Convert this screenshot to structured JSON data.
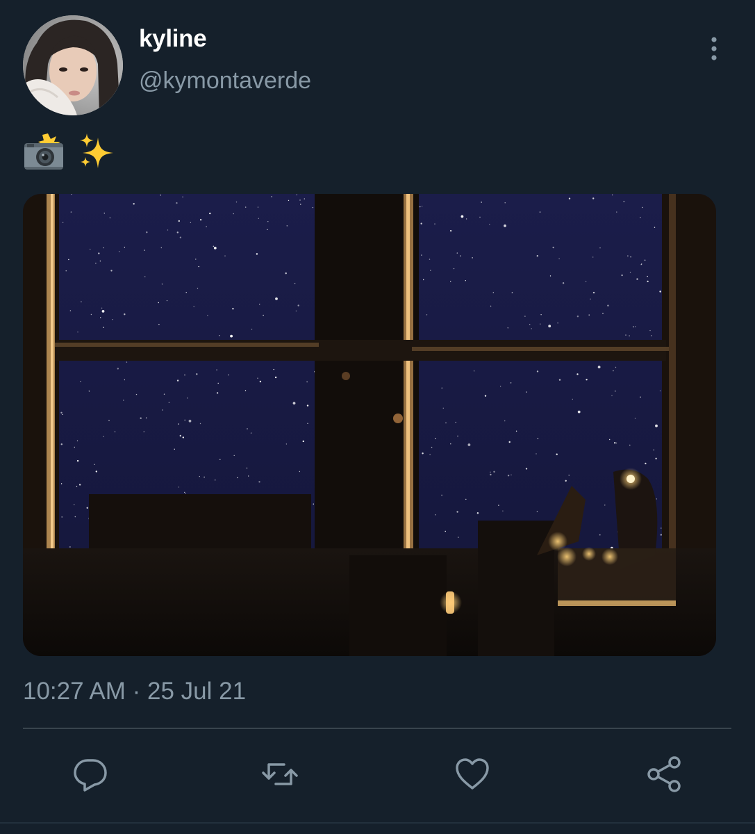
{
  "tweet": {
    "display_name": "kyline",
    "handle": "@kymontaverde",
    "text_emojis": [
      "camera-with-flash",
      "sparkles"
    ],
    "timestamp": "10:27 AM · 25 Jul 21"
  },
  "actions": {
    "icons": [
      "reply-icon",
      "retweet-icon",
      "like-icon",
      "share-icon"
    ]
  },
  "colors": {
    "background": "#15202b",
    "secondary_text": "#8899a6",
    "divider": "#38444d"
  }
}
